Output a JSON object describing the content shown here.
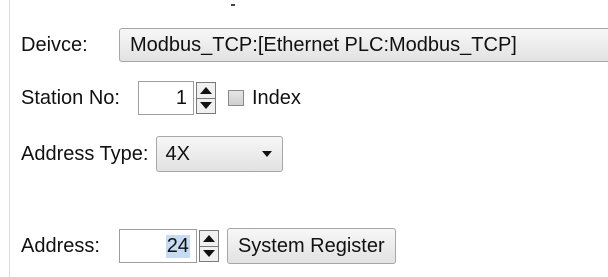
{
  "device": {
    "label": "Deivce:",
    "value": "Modbus_TCP:[Ethernet PLC:Modbus_TCP]"
  },
  "station": {
    "label": "Station No:",
    "value": "1",
    "index_label": "Index",
    "index_checked": false
  },
  "address_type": {
    "label": "Address Type:",
    "value": "4X"
  },
  "address": {
    "label": "Address:",
    "value": "24",
    "system_register_label": "System Register"
  },
  "icons": {
    "spin_up": "triangle-up-icon",
    "spin_down": "triangle-down-icon",
    "dropdown": "chevron-down-icon"
  },
  "colors": {
    "selection": "#c7dcf2",
    "button_border": "#a7a7a7"
  }
}
